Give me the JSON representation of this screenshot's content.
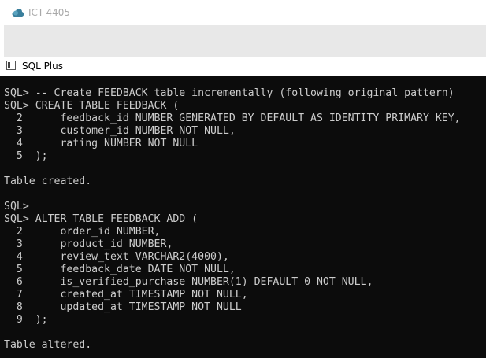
{
  "window": {
    "title": "ICT-4405",
    "app_title": "SQL Plus"
  },
  "console": {
    "lines": [
      "SQL> -- Create FEEDBACK table incrementally (following original pattern)",
      "SQL> CREATE TABLE FEEDBACK (",
      "  2      feedback_id NUMBER GENERATED BY DEFAULT AS IDENTITY PRIMARY KEY,",
      "  3      customer_id NUMBER NOT NULL,",
      "  4      rating NUMBER NOT NULL",
      "  5  );",
      "",
      "Table created.",
      "",
      "SQL>",
      "SQL> ALTER TABLE FEEDBACK ADD (",
      "  2      order_id NUMBER,",
      "  3      product_id NUMBER,",
      "  4      review_text VARCHAR2(4000),",
      "  5      feedback_date DATE NOT NULL,",
      "  6      is_verified_purchase NUMBER(1) DEFAULT 0 NOT NULL,",
      "  7      created_at TIMESTAMP NOT NULL,",
      "  8      updated_at TIMESTAMP NOT NULL",
      "  9  );",
      "",
      "Table altered."
    ]
  },
  "colors": {
    "console_bg": "#0c0c0c",
    "console_text": "#cccccc",
    "toolbar_band": "#e8e8e8",
    "title_text": "#a9a9a9",
    "cloud_icon": "#3a7f9c"
  },
  "icons": {
    "title": "cloud-icon",
    "app": "console-window-icon"
  }
}
